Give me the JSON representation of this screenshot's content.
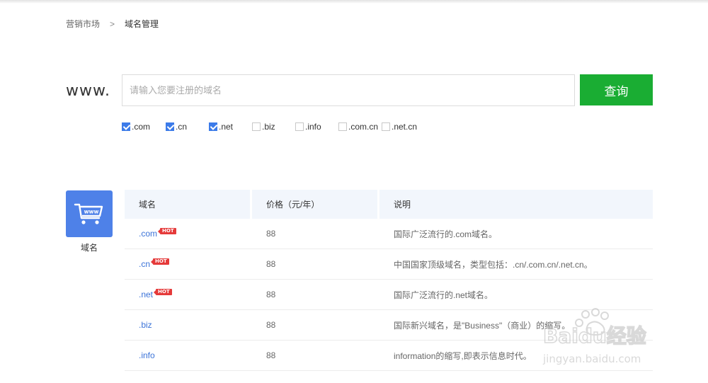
{
  "breadcrumb": {
    "parent": "营销市场",
    "separator": ">",
    "current": "域名管理"
  },
  "search": {
    "prefix": "www.",
    "placeholder": "请输入您要注册的域名",
    "value": "",
    "button_label": "查询"
  },
  "tld_options": [
    {
      "label": ".com",
      "checked": true
    },
    {
      "label": ".cn",
      "checked": true
    },
    {
      "label": ".net",
      "checked": true
    },
    {
      "label": ".biz",
      "checked": false
    },
    {
      "label": ".info",
      "checked": false
    },
    {
      "label": ".com.cn",
      "checked": false
    },
    {
      "label": ".net.cn",
      "checked": false
    }
  ],
  "category": {
    "label": "域名",
    "icon": "cart-www-icon",
    "icon_color": "#4e81e8"
  },
  "table": {
    "headers": [
      "域名",
      "价格（元/年）",
      "说明"
    ],
    "rows": [
      {
        "name": ".com",
        "hot": true,
        "price": "88",
        "desc": "国际广泛流行的.com域名。"
      },
      {
        "name": ".cn",
        "hot": true,
        "price": "88",
        "desc": "中国国家顶级域名，类型包括：.cn/.com.cn/.net.cn。"
      },
      {
        "name": ".net",
        "hot": true,
        "price": "88",
        "desc": "国际广泛流行的.net域名。"
      },
      {
        "name": ".biz",
        "hot": false,
        "price": "88",
        "desc": "国际新兴域名，是\"Business\"（商业）的缩写。"
      },
      {
        "name": ".info",
        "hot": false,
        "price": "88",
        "desc": "information的缩写,即表示信息时代。"
      }
    ],
    "hot_label": "HOT"
  },
  "watermark": {
    "brand": "Baidu经验",
    "url": "jingyan.baidu.com"
  },
  "colors": {
    "accent_green": "#1aad33",
    "link_blue": "#3b73d8",
    "checkbox_blue": "#3c7be9",
    "hot_red": "#e53a3a",
    "header_bg": "#f2f6fc"
  }
}
